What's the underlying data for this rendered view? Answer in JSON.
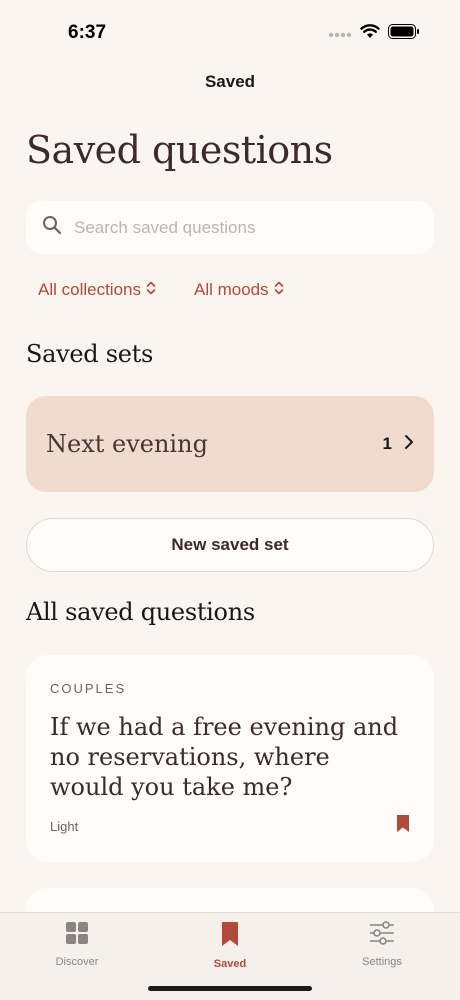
{
  "status_bar": {
    "time": "6:37"
  },
  "nav": {
    "title": "Saved"
  },
  "page": {
    "title": "Saved questions"
  },
  "search": {
    "placeholder": "Search saved questions",
    "value": ""
  },
  "filters": [
    {
      "label": "All collections"
    },
    {
      "label": "All moods"
    }
  ],
  "saved_sets": {
    "title": "Saved sets",
    "items": [
      {
        "name": "Next evening",
        "count": "1"
      }
    ],
    "new_button_label": "New saved set"
  },
  "all_saved": {
    "title": "All saved questions",
    "questions": [
      {
        "category": "COUPLES",
        "text": "If we had a free evening and no reservations, where would you take me?",
        "mood": "Light",
        "bookmarked": true
      }
    ]
  },
  "tab_bar": {
    "tabs": [
      {
        "label": "Discover",
        "icon": "grid-icon",
        "active": false
      },
      {
        "label": "Saved",
        "icon": "bookmark-icon",
        "active": true
      },
      {
        "label": "Settings",
        "icon": "sliders-icon",
        "active": false
      }
    ]
  },
  "colors": {
    "background": "#FBF5F0",
    "accent": "#B04A3A",
    "set_card": "#F1DBCF",
    "card": "#FFFCF9"
  }
}
